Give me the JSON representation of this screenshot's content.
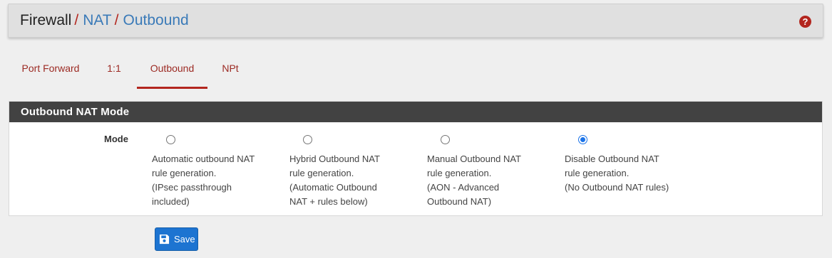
{
  "breadcrumb": {
    "root": "Firewall",
    "separator": "/",
    "items": [
      "NAT",
      "Outbound"
    ]
  },
  "help_icon": "question-circle-icon",
  "tabs": [
    {
      "label": "Port Forward",
      "active": false
    },
    {
      "label": "1:1",
      "active": false
    },
    {
      "label": "Outbound",
      "active": true
    },
    {
      "label": "NPt",
      "active": false
    }
  ],
  "panel": {
    "title": "Outbound NAT Mode",
    "mode_label": "Mode",
    "options": [
      {
        "lines": [
          "Automatic outbound NAT",
          "rule generation.",
          "(IPsec passthrough",
          "included)"
        ],
        "checked": false
      },
      {
        "lines": [
          "Hybrid Outbound NAT",
          "rule generation.",
          "(Automatic Outbound",
          "NAT + rules below)"
        ],
        "checked": false
      },
      {
        "lines": [
          "Manual Outbound NAT",
          "rule generation.",
          "(AON - Advanced",
          "Outbound NAT)"
        ],
        "checked": false
      },
      {
        "lines": [
          "Disable Outbound NAT",
          "rule generation.",
          "(No Outbound NAT rules)"
        ],
        "checked": true
      }
    ]
  },
  "save": {
    "label": "Save",
    "icon": "save-icon"
  },
  "colors": {
    "accent": "#b3261e",
    "link": "#3a7ab8",
    "panel_header": "#424242",
    "save_button": "#1d74d1"
  }
}
